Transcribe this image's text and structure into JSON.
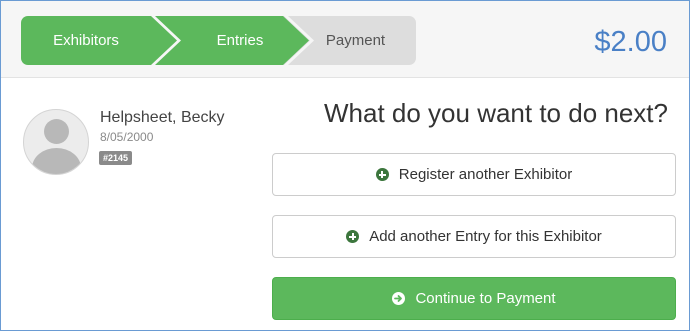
{
  "steps": [
    {
      "label": "Exhibitors",
      "state": "complete"
    },
    {
      "label": "Entries",
      "state": "complete"
    },
    {
      "label": "Payment",
      "state": "current"
    }
  ],
  "total": "$2.00",
  "exhibitor": {
    "name": "Helpsheet, Becky",
    "dob": "8/05/2000",
    "id": "#2145"
  },
  "question": "What do you want to do next?",
  "actions": {
    "register_label": "Register another Exhibitor",
    "add_entry_label": "Add another Entry for this Exhibitor",
    "continue_label": "Continue to Payment"
  },
  "icons": {
    "register": "plus-circle-icon",
    "add_entry": "plus-circle-icon",
    "continue": "arrow-circle-right-icon"
  },
  "colors": {
    "accent_green": "#5cb85c",
    "total_blue": "#4a80c6",
    "inactive_step": "#dddddd"
  }
}
